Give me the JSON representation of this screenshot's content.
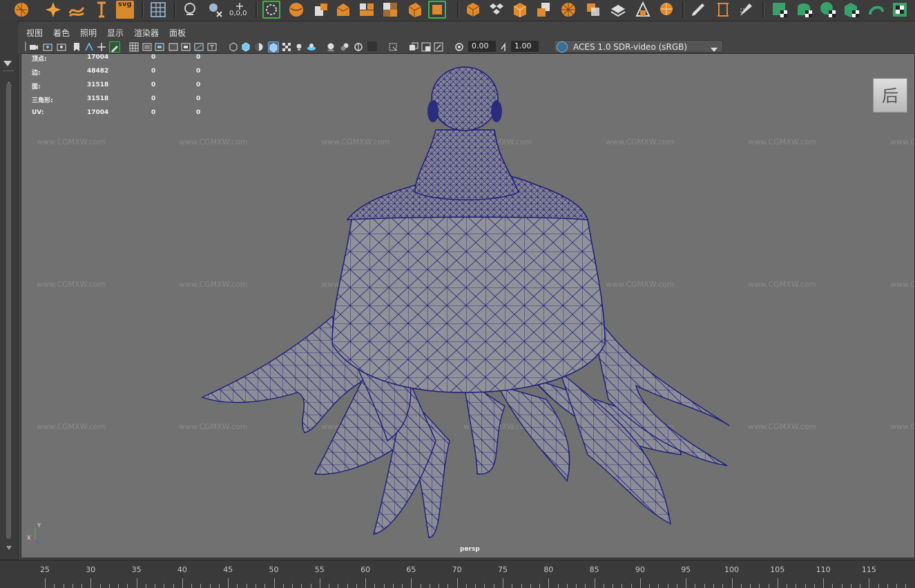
{
  "shelf": {
    "icons": [
      "polygon-sphere-icon",
      "sparkle-icon",
      "curve-tool-icon",
      "text-tool-icon",
      "svg-icon",
      "grid-icon",
      "snap-icon",
      "snap-x-icon",
      "origin-icon",
      "lasso-select-icon",
      "cube-icon",
      "bevel-icon",
      "extrude-icon",
      "bridge-icon",
      "multi-cut-icon",
      "insert-edge-loop-icon",
      "merge-icon",
      "fill-hole-icon",
      "target-weld-icon",
      "sculpt-icon",
      "soft-select-icon",
      "paint-icon",
      "deformer-icon",
      "pencil-icon",
      "measure-icon",
      "brush-icon",
      "uv-editor-icon",
      "uv-layout-icon",
      "uv-unfold-icon",
      "uv-cut-icon",
      "uv-sew-icon",
      "uv-checker-icon"
    ],
    "svg_label": "svg",
    "origin_label": "0,0,0"
  },
  "menubar": {
    "items": [
      "视图",
      "着色",
      "照明",
      "显示",
      "渲染器",
      "面板"
    ]
  },
  "panel_toolbar": {
    "exposure_value": "0.00",
    "gamma_value": "1.00",
    "color_space": "ACES 1.0 SDR-video (sRGB)"
  },
  "hud": {
    "rows": [
      {
        "label": "顶点:",
        "v1": "17004",
        "v2": "0",
        "v3": "0"
      },
      {
        "label": "边:",
        "v1": "48482",
        "v2": "0",
        "v3": "0"
      },
      {
        "label": "面:",
        "v1": "31518",
        "v2": "0",
        "v3": "0"
      },
      {
        "label": "三角形:",
        "v1": "31518",
        "v2": "0",
        "v3": "0"
      },
      {
        "label": "UV:",
        "v1": "17004",
        "v2": "0",
        "v3": "0"
      }
    ]
  },
  "viewport": {
    "camera": "persp",
    "viewcube_face": "后",
    "watermark_site": "www.CGMXW.com",
    "axis": {
      "y": "Y",
      "x": "X"
    }
  },
  "timeline": {
    "ticks": [
      "25",
      "30",
      "35",
      "40",
      "45",
      "50",
      "55",
      "60",
      "65",
      "70",
      "75",
      "80",
      "85",
      "90",
      "95",
      "100",
      "105",
      "110",
      "115"
    ]
  },
  "colors": {
    "mesh_wire": "#1c1d7a",
    "mesh_fill": "#8b8b95",
    "viewport_bg": "#717171",
    "shelf_orange": "#e08a2e",
    "shelf_green": "#39a26a"
  }
}
